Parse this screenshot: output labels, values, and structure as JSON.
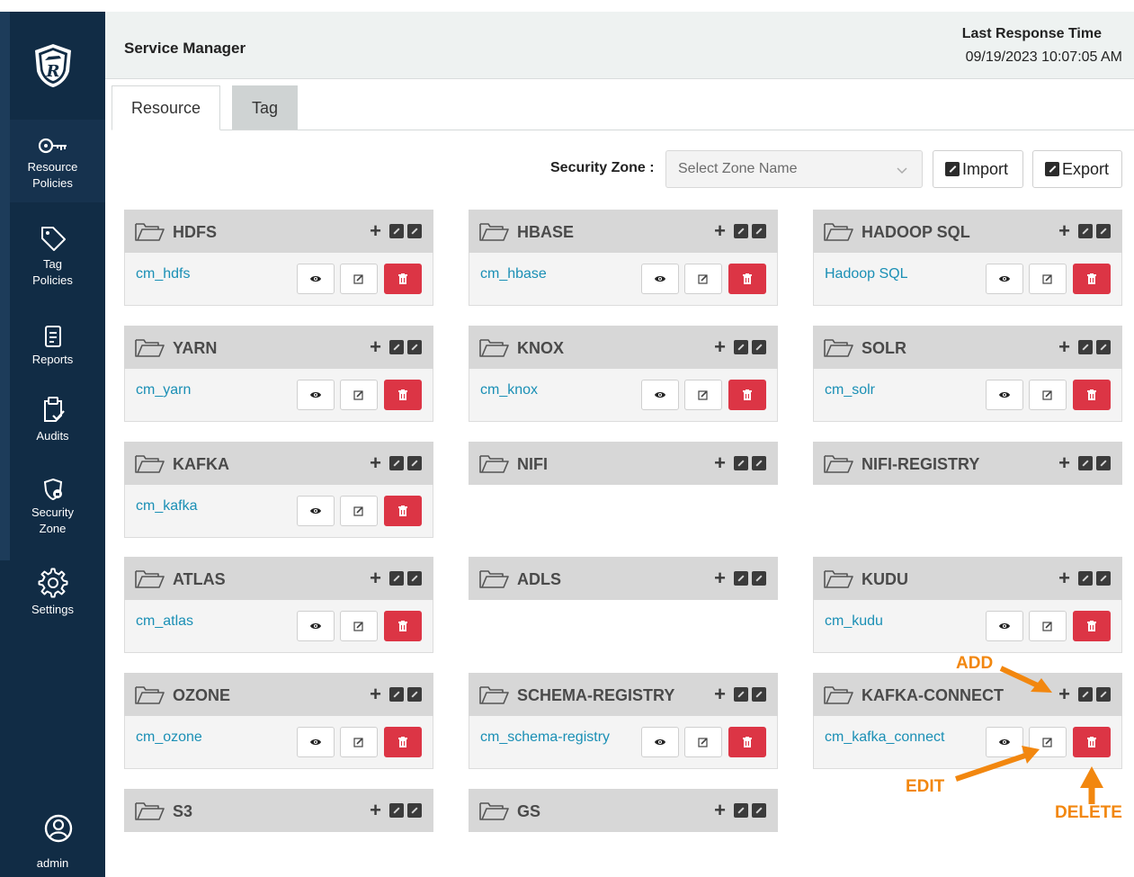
{
  "sidebar": {
    "items": [
      {
        "label": "Resource Policies",
        "icon": "key-icon"
      },
      {
        "label": "Tag Policies",
        "icon": "tag-icon"
      },
      {
        "label": "Reports",
        "icon": "report-icon"
      },
      {
        "label": "Audits",
        "icon": "clipboard-check-icon"
      },
      {
        "label": "Security Zone",
        "icon": "shield-lock-icon"
      },
      {
        "label": "Settings",
        "icon": "gear-icon"
      }
    ],
    "user": "admin"
  },
  "header": {
    "title": "Service Manager",
    "response_title": "Last Response Time",
    "response_time": "09/19/2023 10:07:05 AM"
  },
  "tabs": [
    "Resource",
    "Tag"
  ],
  "zone": {
    "label": "Security Zone :",
    "placeholder": "Select Zone Name"
  },
  "buttons": {
    "import": "Import",
    "export": "Export"
  },
  "services": [
    {
      "name": "HDFS",
      "repo": "cm_hdfs"
    },
    {
      "name": "HBASE",
      "repo": "cm_hbase"
    },
    {
      "name": "HADOOP SQL",
      "repo": "Hadoop SQL"
    },
    {
      "name": "YARN",
      "repo": "cm_yarn"
    },
    {
      "name": "KNOX",
      "repo": "cm_knox"
    },
    {
      "name": "SOLR",
      "repo": "cm_solr"
    },
    {
      "name": "KAFKA",
      "repo": "cm_kafka"
    },
    {
      "name": "NIFI",
      "repo": ""
    },
    {
      "name": "NIFI-REGISTRY",
      "repo": ""
    },
    {
      "name": "ATLAS",
      "repo": "cm_atlas"
    },
    {
      "name": "ADLS",
      "repo": ""
    },
    {
      "name": "KUDU",
      "repo": "cm_kudu"
    },
    {
      "name": "OZONE",
      "repo": "cm_ozone"
    },
    {
      "name": "SCHEMA-REGISTRY",
      "repo": "cm_schema-registry"
    },
    {
      "name": "KAFKA-CONNECT",
      "repo": "cm_kafka_connect"
    },
    {
      "name": "S3",
      "repo": ""
    },
    {
      "name": "GS",
      "repo": ""
    }
  ],
  "annotations": {
    "add": "ADD",
    "edit": "EDIT",
    "delete": "DELETE"
  },
  "colors": {
    "sidebar": "#112c45",
    "link": "#1a8fb5",
    "delete": "#dc3545",
    "annotation": "#f2870f"
  }
}
